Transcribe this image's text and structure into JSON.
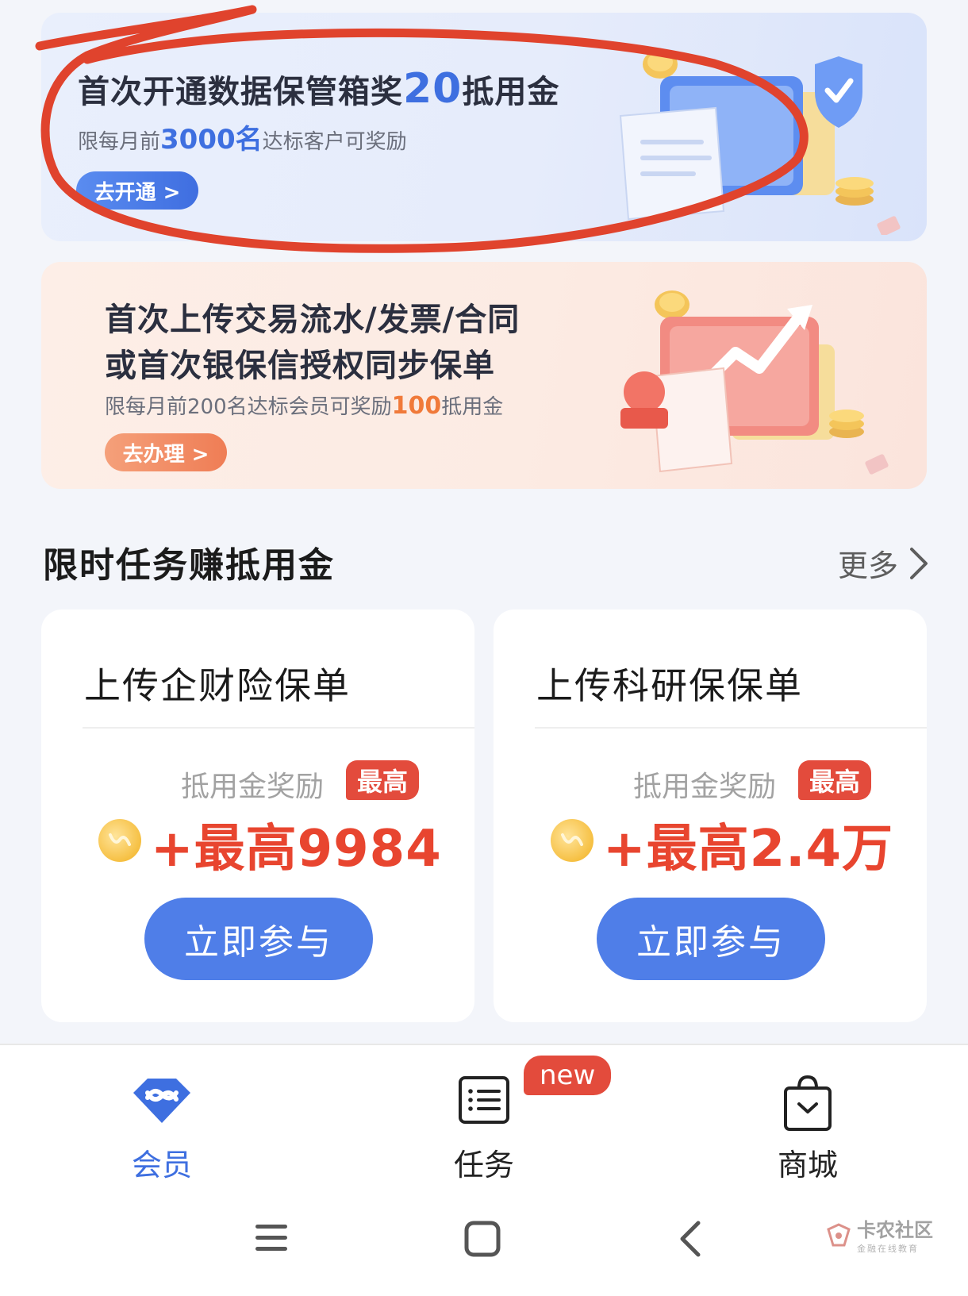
{
  "banner_vault": {
    "title_prefix": "首次开通数据保管箱奖",
    "title_number": "20",
    "title_suffix": "抵用金",
    "sub_prefix": "限每月前",
    "sub_number": "3000名",
    "sub_suffix": "达标客户可奖励",
    "button": "去开通 >"
  },
  "banner_upload": {
    "title_line1": "首次上传交易流水/发票/合同",
    "title_line2": "或首次银保信授权同步保单",
    "sub_prefix": "限每月前200名达标会员可奖励",
    "sub_number": "100",
    "sub_suffix": "抵用金",
    "button": "去办理 >"
  },
  "section": {
    "title": "限时任务赚抵用金",
    "more": "更多"
  },
  "tasks": [
    {
      "title": "上传企财险保单",
      "reward_label": "抵用金奖励",
      "badge": "最高",
      "amount": "+最高9984",
      "button": "立即参与"
    },
    {
      "title": "上传科研保保单",
      "reward_label": "抵用金奖励",
      "badge": "最高",
      "amount": "+最高2.4万",
      "button": "立即参与"
    }
  ],
  "tabbar": {
    "member": "会员",
    "tasks": "任务",
    "tasks_badge": "new",
    "mall": "商城",
    "active_color": "#3e6fe0",
    "inactive_color": "#222222"
  },
  "watermark": {
    "title": "卡农社区",
    "subtitle": "金融在线教育"
  },
  "colors": {
    "accent_blue": "#4f7ee8",
    "accent_red": "#e8452f",
    "annotation_red": "#e0432d"
  }
}
